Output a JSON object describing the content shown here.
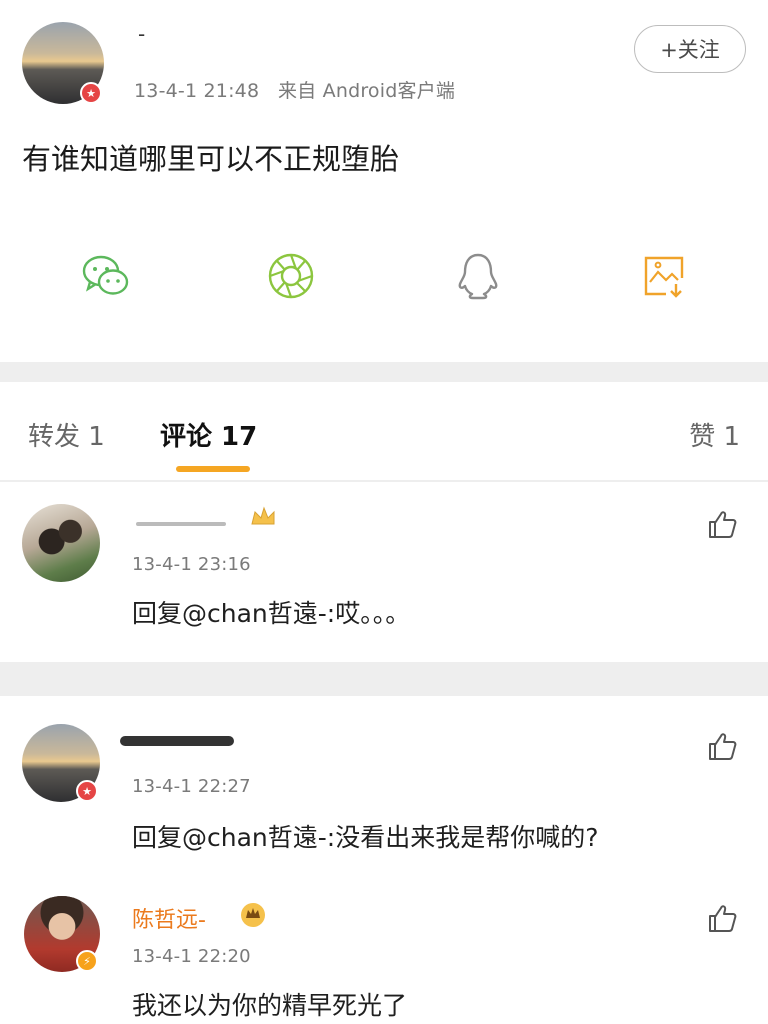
{
  "post": {
    "author_name": "-",
    "timestamp": "13-4-1 21:48",
    "source": "来自 Android客户端",
    "follow_label": "+关注",
    "text": "有谁知道哪里可以不正规堕胎",
    "share_icons": [
      "wechat-icon",
      "moments-icon",
      "qq-icon",
      "save-image-icon"
    ]
  },
  "tabs": {
    "repost": "转发 1",
    "comment": "评论 17",
    "like": "赞 1"
  },
  "comments": [
    {
      "timestamp": "13-4-1 23:16",
      "text": "回复@chan哲遠-:哎。。。"
    },
    {
      "timestamp": "13-4-1 22:27",
      "text": "回复@chan哲遠-:没看出来我是帮你喊的?"
    },
    {
      "name": "陈哲远-",
      "timestamp": "13-4-1 22:20",
      "text": "我还以为你的精早死光了"
    }
  ],
  "colors": {
    "accent": "#f5a623",
    "reply_name": "#eb7a1d",
    "badge_red": "#e54545"
  }
}
